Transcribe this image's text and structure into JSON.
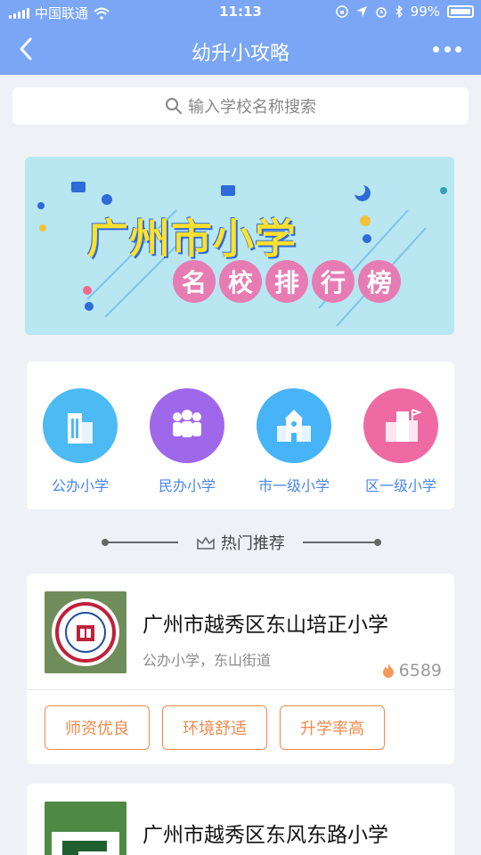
{
  "status": {
    "carrier": "中国联通",
    "time": "11:13",
    "battery": "99%"
  },
  "nav": {
    "title": "幼升小攻略"
  },
  "search": {
    "placeholder": "输入学校名称搜索"
  },
  "banner": {
    "title": "广州市小学",
    "subtitle_chars": [
      "名",
      "校",
      "排",
      "行",
      "榜"
    ]
  },
  "categories": [
    {
      "label": "公办小学",
      "color": "#4cbaf3",
      "icon": "building-icon"
    },
    {
      "label": "民办小学",
      "color": "#9f67ea",
      "icon": "people-icon"
    },
    {
      "label": "市一级小学",
      "color": "#47b4f7",
      "icon": "school-icon"
    },
    {
      "label": "区一级小学",
      "color": "#ef6aa3",
      "icon": "district-icon"
    }
  ],
  "hot_section": {
    "label": "热门推荐"
  },
  "schools": [
    {
      "name": "广州市越秀区东山培正小学",
      "meta": "公办小学，东山街道",
      "hot": "6589",
      "tags": [
        "师资优良",
        "环境舒适",
        "升学率高"
      ]
    },
    {
      "name": "广州市越秀区东风东路小学"
    }
  ]
}
